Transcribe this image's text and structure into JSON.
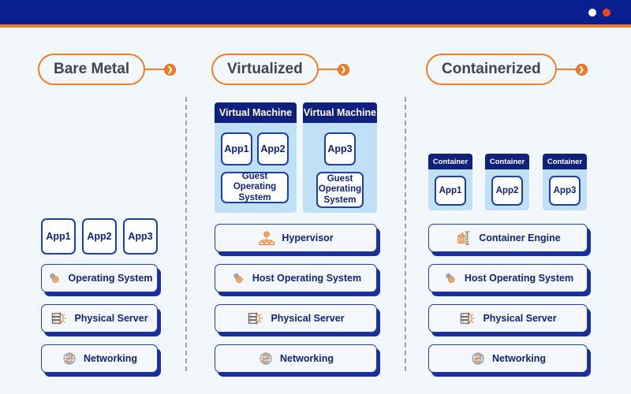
{
  "window": {
    "accent_color": "#f07e26",
    "bar_color": "#0a1f8f",
    "dots": [
      {
        "name": "window-dot-white",
        "color": "#ffffff"
      },
      {
        "name": "window-dot-orange",
        "color": "#ef4a15"
      }
    ]
  },
  "theme": {
    "background": "#f2f7fb",
    "navy": "#12237e",
    "navy_border": "#1f3fa8",
    "shadow_navy": "#1a2f9e",
    "orange": "#f07e26",
    "panel_blue": "#bfe0f5",
    "panel_header_navy": "#10217d",
    "divider_gray": "#9aa3ae"
  },
  "columns": [
    {
      "id": "bare-metal",
      "title": "Bare Metal",
      "knob_icon": "chevron-right-icon",
      "apps": [
        {
          "label": "App1"
        },
        {
          "label": "App2"
        },
        {
          "label": "App3"
        }
      ],
      "rows": [
        {
          "label": "Operating System",
          "icon": "gears-icon"
        },
        {
          "label": "Physical Server",
          "icon": "server-gear-icon"
        },
        {
          "label": "Networking",
          "icon": "globe-icon"
        }
      ]
    },
    {
      "id": "virtualized",
      "title": "Virtualized",
      "knob_icon": "chevron-right-icon",
      "vms": [
        {
          "title": "Virtual Machine",
          "apps": [
            {
              "label": "App1"
            },
            {
              "label": "App2"
            }
          ],
          "guest_os": "Guest Operating System"
        },
        {
          "title": "Virtual Machine",
          "apps": [
            {
              "label": "App3"
            }
          ],
          "guest_os": "Guest Operating System"
        }
      ],
      "rows": [
        {
          "label": "Hypervisor",
          "icon": "hypervisor-icon"
        },
        {
          "label": "Host Operating System",
          "icon": "gears-icon"
        },
        {
          "label": "Physical Server",
          "icon": "server-gear-icon"
        },
        {
          "label": "Networking",
          "icon": "globe-icon"
        }
      ]
    },
    {
      "id": "containerized",
      "title": "Containerized",
      "knob_icon": "chevron-right-icon",
      "containers": [
        {
          "title": "Container",
          "app": "App1"
        },
        {
          "title": "Container",
          "app": "App2"
        },
        {
          "title": "Container",
          "app": "App3"
        }
      ],
      "rows": [
        {
          "label": "Container Engine",
          "icon": "crane-container-icon"
        },
        {
          "label": "Host Operating System",
          "icon": "gears-icon"
        },
        {
          "label": "Physical Server",
          "icon": "server-gear-icon"
        },
        {
          "label": "Networking",
          "icon": "globe-icon"
        }
      ]
    }
  ]
}
